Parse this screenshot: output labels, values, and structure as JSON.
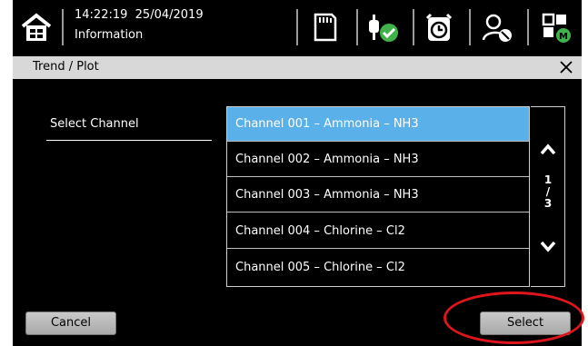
{
  "header": {
    "time": "14:22:19",
    "date": "25/04/2019",
    "subtitle": "Information"
  },
  "window": {
    "title": "Trend / Plot"
  },
  "main": {
    "select_channel_label": "Select Channel",
    "channels": [
      {
        "label": "Channel 001 – Ammonia – NH3",
        "selected": true
      },
      {
        "label": "Channel 002 – Ammonia – NH3",
        "selected": false
      },
      {
        "label": "Channel 003 – Ammonia – NH3",
        "selected": false
      },
      {
        "label": "Channel 004 – Chlorine – Cl2",
        "selected": false
      },
      {
        "label": "Channel 005 – Chlorine – Cl2",
        "selected": false
      }
    ],
    "page": {
      "current": "1",
      "sep": "/",
      "total": "3"
    }
  },
  "buttons": {
    "cancel": "Cancel",
    "select": "Select"
  },
  "colors": {
    "selected_row": "#5ab0e8",
    "status_green": "#3fb24a",
    "annotation_red": "#e0151b"
  },
  "icons": [
    "home-icon",
    "sd-card-icon",
    "power-plug-ok-icon",
    "alarm-clock-icon",
    "user-settings-icon",
    "module-grid-icon",
    "close-icon",
    "chevron-up-icon",
    "chevron-down-icon"
  ]
}
